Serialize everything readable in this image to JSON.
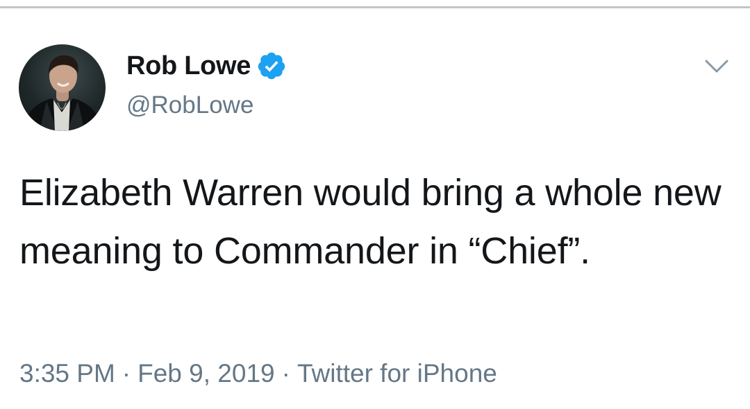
{
  "tweet": {
    "display_name": "Rob Lowe",
    "handle": "@RobLowe",
    "verified": true,
    "text": "Elizabeth Warren would bring a whole new meaning to Commander in “Chief”.",
    "time": "3:35 PM",
    "separator": "·",
    "date": "Feb 9, 2019",
    "source": "Twitter for iPhone"
  },
  "icons": {
    "verified": "verified-badge-icon",
    "menu": "chevron-down-icon"
  },
  "colors": {
    "verified_blue": "#1da1f2",
    "text_primary": "#14171a",
    "text_secondary": "#657786",
    "divider": "#c4c4c4"
  }
}
